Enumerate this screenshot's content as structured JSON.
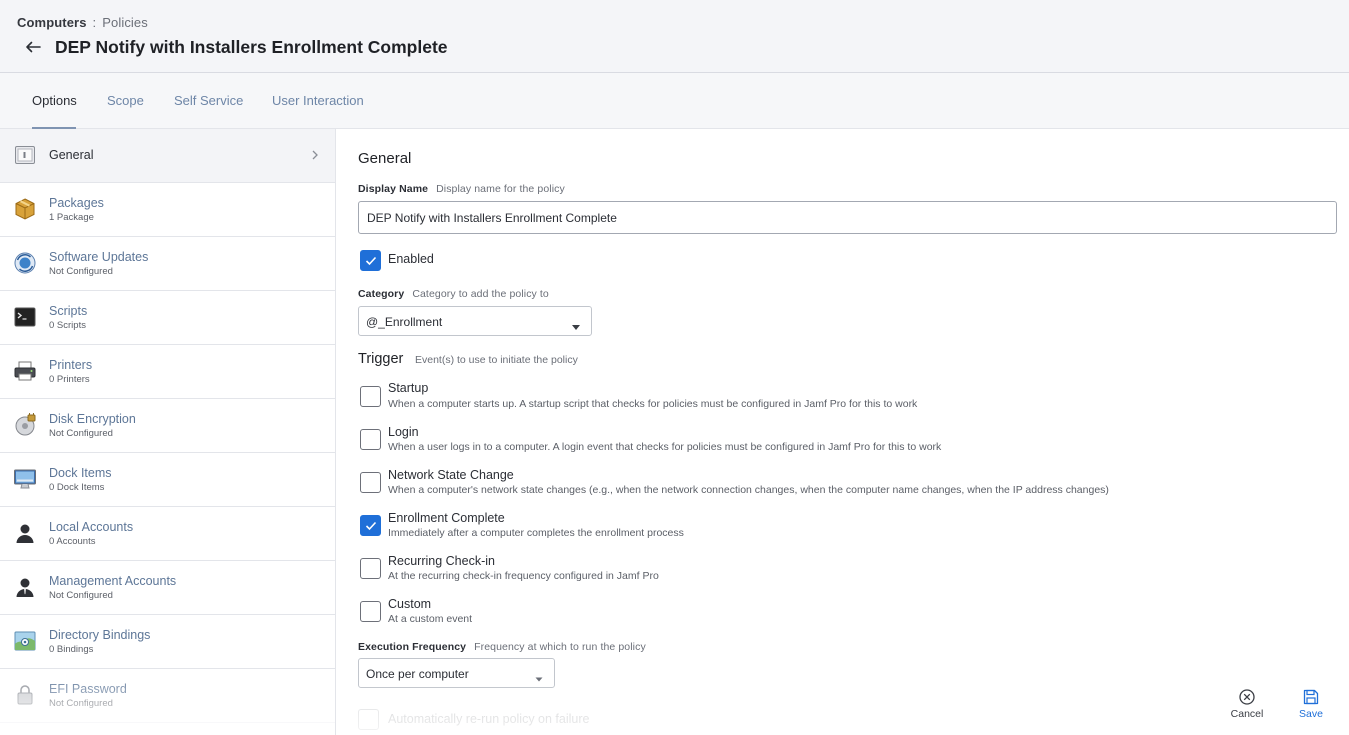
{
  "breadcrumb": {
    "root": "Computers",
    "separator": ":",
    "leaf": "Policies"
  },
  "page_title": "DEP Notify with Installers Enrollment Complete",
  "tabs": [
    {
      "label": "Options",
      "active": true
    },
    {
      "label": "Scope"
    },
    {
      "label": "Self Service"
    },
    {
      "label": "User Interaction"
    }
  ],
  "sidebar": {
    "items": [
      {
        "label": "General",
        "sub": "",
        "icon": "general-icon",
        "active": true
      },
      {
        "label": "Packages",
        "sub": "1 Package",
        "icon": "package-icon"
      },
      {
        "label": "Software Updates",
        "sub": "Not Configured",
        "icon": "software-update-icon"
      },
      {
        "label": "Scripts",
        "sub": "0 Scripts",
        "icon": "terminal-icon"
      },
      {
        "label": "Printers",
        "sub": "0 Printers",
        "icon": "printer-icon"
      },
      {
        "label": "Disk Encryption",
        "sub": "Not Configured",
        "icon": "disk-encryption-icon"
      },
      {
        "label": "Dock Items",
        "sub": "0 Dock Items",
        "icon": "monitor-icon"
      },
      {
        "label": "Local Accounts",
        "sub": "0 Accounts",
        "icon": "user-icon"
      },
      {
        "label": "Management Accounts",
        "sub": "Not Configured",
        "icon": "admin-user-icon"
      },
      {
        "label": "Directory Bindings",
        "sub": "0 Bindings",
        "icon": "directory-icon"
      },
      {
        "label": "EFI Password",
        "sub": "Not Configured",
        "icon": "lock-icon"
      }
    ]
  },
  "general": {
    "title": "General",
    "display_name": {
      "label": "Display Name",
      "hint": "Display name for the policy",
      "value": "DEP Notify with Installers Enrollment Complete"
    },
    "enabled": {
      "label": "Enabled",
      "checked": true
    },
    "category": {
      "label": "Category",
      "hint": "Category to add the policy to",
      "value": "@_Enrollment"
    },
    "trigger": {
      "title": "Trigger",
      "hint": "Event(s) to use to initiate the policy",
      "options": [
        {
          "label": "Startup",
          "desc": "When a computer starts up. A startup script that checks for policies must be configured in Jamf Pro for this to work",
          "checked": false
        },
        {
          "label": "Login",
          "desc": "When a user logs in to a computer. A login event that checks for policies must be configured in Jamf Pro for this to work",
          "checked": false
        },
        {
          "label": "Network State Change",
          "desc": "When a computer's network state changes (e.g., when the network connection changes, when the computer name changes, when the IP address changes)",
          "checked": false
        },
        {
          "label": "Enrollment Complete",
          "desc": "Immediately after a computer completes the enrollment process",
          "checked": true
        },
        {
          "label": "Recurring Check-in",
          "desc": "At the recurring check-in frequency configured in Jamf Pro",
          "checked": false
        },
        {
          "label": "Custom",
          "desc": "At a custom event",
          "checked": false
        }
      ]
    },
    "execution_frequency": {
      "label": "Execution Frequency",
      "hint": "Frequency at which to run the policy",
      "value": "Once per computer"
    },
    "auto_rerun": {
      "label": "Automatically re-run policy on failure",
      "checked": false
    }
  },
  "actions": {
    "cancel": "Cancel",
    "save": "Save"
  },
  "colors": {
    "accent": "#1f6fd8",
    "sidebar_link": "#5d7697",
    "tab_link": "#6e86a7"
  }
}
